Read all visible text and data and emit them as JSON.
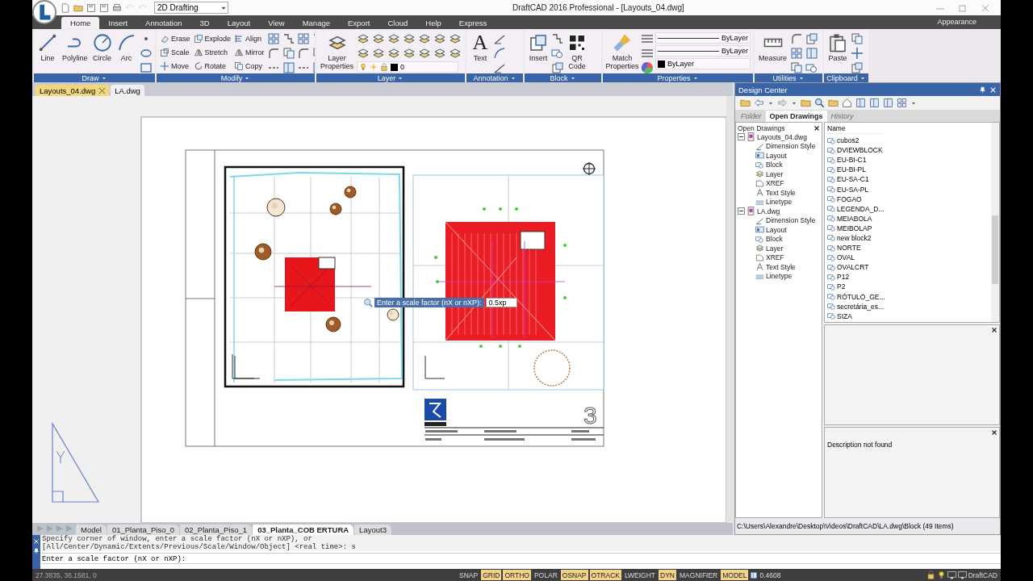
{
  "window": {
    "title": "DraftCAD 2016 Professional - [Layouts_04.dwg]"
  },
  "quick_access": {
    "workspace": "2D Drafting"
  },
  "ribbon_tabs": [
    {
      "label": "Home",
      "selected": true
    },
    {
      "label": "Insert",
      "selected": false
    },
    {
      "label": "Annotation",
      "selected": false
    },
    {
      "label": "3D",
      "selected": false
    },
    {
      "label": "Layout",
      "selected": false
    },
    {
      "label": "View",
      "selected": false
    },
    {
      "label": "Manage",
      "selected": false
    },
    {
      "label": "Export",
      "selected": false
    },
    {
      "label": "Cloud",
      "selected": false
    },
    {
      "label": "Help",
      "selected": false
    },
    {
      "label": "Express",
      "selected": false
    }
  ],
  "appearance": "Appearance",
  "ribbon_panels": [
    {
      "title": "Draw",
      "tools": [
        {
          "label": "Line",
          "kind": "large"
        },
        {
          "label": "Polyline",
          "kind": "large"
        },
        {
          "label": "Circle",
          "kind": "large"
        },
        {
          "label": "Arc",
          "kind": "large"
        }
      ]
    },
    {
      "title": "Modify",
      "tools": [
        {
          "label": "Erase",
          "kind": "small"
        },
        {
          "label": "Scale",
          "kind": "small"
        },
        {
          "label": "Move",
          "kind": "small"
        },
        {
          "label": "Explode",
          "kind": "small"
        },
        {
          "label": "Stretch",
          "kind": "small"
        },
        {
          "label": "Rotate",
          "kind": "small"
        },
        {
          "label": "Align",
          "kind": "small"
        },
        {
          "label": "Mirror",
          "kind": "small"
        },
        {
          "label": "Copy",
          "kind": "small"
        }
      ]
    },
    {
      "title": "Layer",
      "tools": [
        {
          "label": "Layer Properties",
          "kind": "large"
        },
        {
          "kind": "layer_select",
          "value": "0"
        }
      ]
    },
    {
      "title": "Annotation",
      "tools": [
        {
          "label": "Text",
          "glyph": "A",
          "kind": "large"
        }
      ]
    },
    {
      "title": "Block",
      "tools": [
        {
          "label": "Insert",
          "kind": "large"
        },
        {
          "label": "QR Code",
          "kind": "large"
        }
      ]
    },
    {
      "title": "Properties",
      "tools": [
        {
          "label": "Match Properties",
          "kind": "large"
        },
        {
          "kind": "select",
          "value": "ByLayer"
        },
        {
          "kind": "select",
          "value": "ByLayer"
        },
        {
          "kind": "color_select",
          "value": "ByLayer"
        }
      ]
    },
    {
      "title": "Utilities",
      "tools": [
        {
          "label": "Measure",
          "kind": "large"
        }
      ]
    },
    {
      "title": "Clipboard",
      "tools": [
        {
          "label": "Paste",
          "kind": "large"
        }
      ]
    }
  ],
  "doc_tabs": [
    {
      "label": "Layouts_04.dwg",
      "selected": true
    },
    {
      "label": "LA.dwg",
      "selected": false
    }
  ],
  "drawing": {
    "sheet_number": "3",
    "prompt": {
      "label": "Enter a scale factor (nX or nXP):",
      "value": "0.5xp"
    }
  },
  "layout_tabs": [
    {
      "label": "Model",
      "selected": false
    },
    {
      "label": "01_Planta_Piso_0",
      "selected": false
    },
    {
      "label": "02_Planta_Piso_1",
      "selected": false
    },
    {
      "label": "03_Planta_COB ERTURA",
      "selected": true
    },
    {
      "label": "Layout3",
      "selected": false
    }
  ],
  "design_center": {
    "title": "Design Center",
    "tabs": [
      {
        "label": "Folder",
        "selected": false,
        "disabled": true
      },
      {
        "label": "Open Drawings",
        "selected": true,
        "disabled": false
      },
      {
        "label": "History",
        "selected": false,
        "disabled": true
      }
    ],
    "tree_title": "Open Drawings",
    "tree": [
      {
        "label": "Layouts_04.dwg",
        "expanded": true,
        "children": [
          {
            "label": "Dimension Style"
          },
          {
            "label": "Layout"
          },
          {
            "label": "Block"
          },
          {
            "label": "Layer"
          },
          {
            "label": "XREF"
          },
          {
            "label": "Text Style"
          },
          {
            "label": "Linetype"
          }
        ]
      },
      {
        "label": "LA.dwg",
        "expanded": true,
        "children": [
          {
            "label": "Dimension Style"
          },
          {
            "label": "Layout"
          },
          {
            "label": "Block"
          },
          {
            "label": "Layer"
          },
          {
            "label": "XREF"
          },
          {
            "label": "Text Style"
          },
          {
            "label": "Linetype"
          }
        ]
      }
    ],
    "list_header": "Name",
    "blocks": [
      "cubos2",
      "DVIEWBLOCK",
      "EU-BI-C1",
      "EU-BI-PL",
      "EU-SA-C1",
      "EU-SA-PL",
      "FOGAO",
      "LEGENDA_D...",
      "MEIABOLA",
      "MEIBOLAP",
      "new block2",
      "NORTE",
      "OVAL",
      "OVALCRT",
      "P12",
      "P2",
      "RÓTULO_GE...",
      "secretária_es...",
      "SIZA"
    ],
    "description": "Description not found",
    "path": "C:\\Users\\Alexandre\\Desktop\\Videos\\DraftCAD\\LA.dwg\\Block  (49  Items)"
  },
  "command": {
    "history": [
      "Specify corner of window, enter a scale factor (nX or nXP), or",
      "[All/Center/Dynamic/Extents/Previous/Scale/Window/Object] <real time>: s"
    ],
    "prompt": "Enter a scale factor (nX or nXP):"
  },
  "status_bar": {
    "coordinates": "27.3835, 36.1581, 0",
    "toggles": [
      {
        "label": "SNAP",
        "on": false
      },
      {
        "label": "GRID",
        "on": true
      },
      {
        "label": "ORTHO",
        "on": true
      },
      {
        "label": "POLAR",
        "on": false
      },
      {
        "label": "OSNAP",
        "on": true
      },
      {
        "label": "OTRACK",
        "on": true
      },
      {
        "label": "LWEIGHT",
        "on": false
      },
      {
        "label": "DYN",
        "on": true
      },
      {
        "label": "MAGNIFIER",
        "on": false
      },
      {
        "label": "MODEL",
        "on": true
      }
    ],
    "scale": "0.4608",
    "brand": "DraftCAD"
  }
}
